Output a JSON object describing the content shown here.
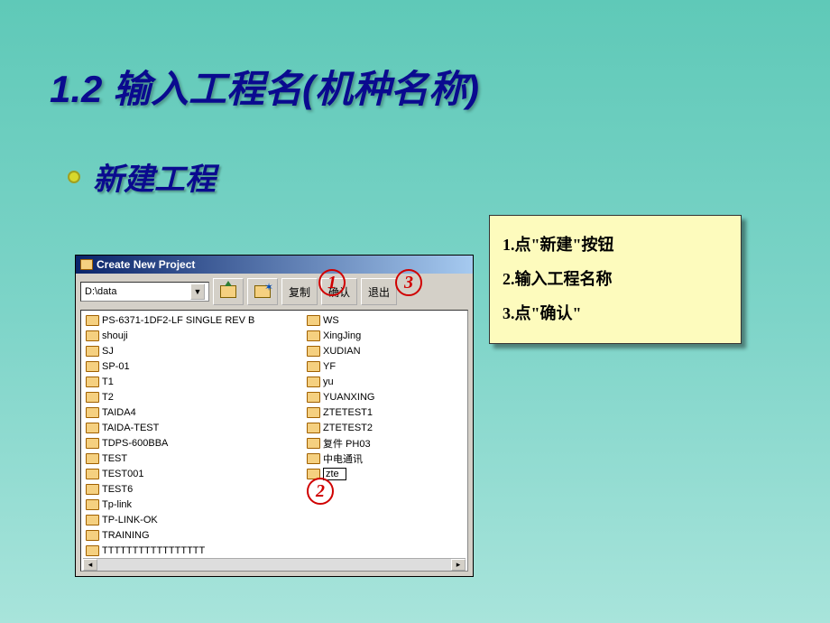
{
  "slide": {
    "title": "1.2    输入工程名(机种名称)",
    "subtitle": "新建工程"
  },
  "callout": {
    "lines": [
      "1.点\"新建\"按钮",
      "2.输入工程名称",
      "3.点\"确认\""
    ]
  },
  "markers": [
    "1",
    "2",
    "3"
  ],
  "dialog": {
    "title": "Create New Project",
    "path": "D:\\data",
    "buttons": {
      "copy": "复制",
      "confirm": "确认",
      "exit": "退出"
    },
    "col1": [
      "PS-6371-1DF2-LF SINGLE REV B",
      "shouji",
      "SJ",
      "SP-01",
      "T1",
      "T2",
      "TAIDA4",
      "TAIDA-TEST",
      "TDPS-600BBA",
      "TEST",
      "TEST001",
      "TEST6",
      "Tp-link",
      "TP-LINK-OK",
      "TRAINING",
      "TTTTTTTTTTTTTTTTT"
    ],
    "col2": [
      "WS",
      "XingJing",
      "XUDIAN",
      "YF",
      "yu",
      "YUANXING",
      "ZTETEST1",
      "ZTETEST2",
      "复件 PH03",
      "中电通讯"
    ],
    "editValue": "zte"
  }
}
